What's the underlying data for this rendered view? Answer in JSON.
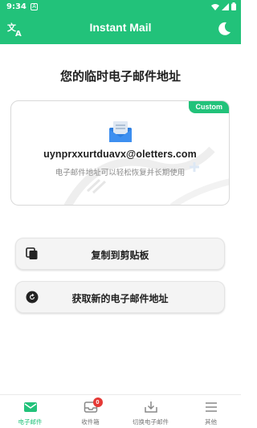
{
  "status_bar": {
    "time": "9:34",
    "notification_glyph": "A",
    "icons": [
      "wifi-icon",
      "signal-icon",
      "battery-icon"
    ]
  },
  "app_bar": {
    "title": "Instant Mail",
    "left_icon": "translate-icon",
    "right_icon": "moon-icon"
  },
  "main": {
    "heading": "您的临时电子邮件地址",
    "card": {
      "badge": "Custom",
      "icon": "mail-icon",
      "email": "uynprxxurtduavx@oletters.com",
      "hint": "电子邮件地址可以轻松恢复并长期使用"
    },
    "actions": [
      {
        "label": "复制到剪贴板",
        "icon": "copy-icon"
      },
      {
        "label": "获取新的电子邮件地址",
        "icon": "refresh-icon"
      }
    ]
  },
  "bottom_nav": {
    "items": [
      {
        "label": "电子邮件",
        "icon": "email-icon",
        "active": true
      },
      {
        "label": "收件箱",
        "icon": "inbox-icon",
        "badge": "0"
      },
      {
        "label": "切换电子邮件",
        "icon": "switch-email-icon"
      },
      {
        "label": "其他",
        "icon": "menu-icon"
      }
    ]
  },
  "colors": {
    "accent": "#22c27a",
    "badge_red": "#e53935",
    "mail_blue": "#2f7fe0"
  }
}
